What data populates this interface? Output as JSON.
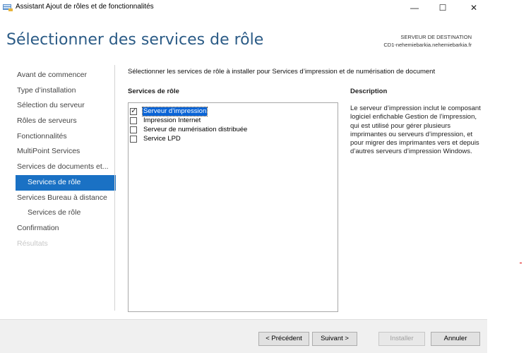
{
  "window": {
    "title": "Assistant Ajout de rôles et de fonctionnalités",
    "minimize": "—",
    "maximize": "☐",
    "close": "✕"
  },
  "header": {
    "page_title": "Sélectionner des services de rôle",
    "dest_label": "SERVEUR DE DESTINATION",
    "dest_server": "CD1-nehemiebarkia.nehemiebarkia.fr"
  },
  "nav": {
    "items": [
      {
        "label": "Avant de commencer"
      },
      {
        "label": "Type d’installation"
      },
      {
        "label": "Sélection du serveur"
      },
      {
        "label": "Rôles de serveurs"
      },
      {
        "label": "Fonctionnalités"
      },
      {
        "label": "MultiPoint Services"
      },
      {
        "label": "Services de documents et..."
      },
      {
        "label": "Services de rôle"
      },
      {
        "label": "Services Bureau à distance"
      },
      {
        "label": "Services de rôle"
      },
      {
        "label": "Confirmation"
      },
      {
        "label": "Résultats"
      }
    ]
  },
  "content": {
    "intro": "Sélectionner les services de rôle à installer pour Services d’impression et de numérisation de document",
    "services_header": "Services de rôle",
    "description_header": "Description",
    "services": [
      {
        "label": "Serveur d’impression",
        "checked": true
      },
      {
        "label": "Impression Internet",
        "checked": false
      },
      {
        "label": "Serveur de numérisation distribuée",
        "checked": false
      },
      {
        "label": "Service LPD",
        "checked": false
      }
    ],
    "description": "Le serveur d’impression inclut le composant logiciel enfichable Gestion de l’impression, qui est utilisé pour gérer plusieurs imprimantes ou serveurs d’impression, et pour migrer des imprimantes vers et depuis d’autres serveurs d’impression Windows."
  },
  "footer": {
    "prev": "< Précédent",
    "next": "Suivant >",
    "install": "Installer",
    "cancel": "Annuler"
  },
  "colors": {
    "title_blue": "#2b5b86",
    "active_nav": "#1a71c4",
    "selection": "#0a64d6"
  }
}
